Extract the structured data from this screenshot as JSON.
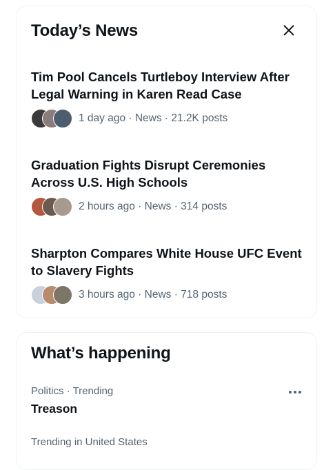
{
  "news": {
    "title": "Today’s News",
    "close_icon": "close-icon",
    "stories": [
      {
        "title": "Tim Pool Cancels Turtleboy Interview After Legal Warning in Karen Read Case",
        "meta": "1 day ago · News · 21.2K posts",
        "avatar_colors": [
          "#3b3b3b",
          "#8a7c78",
          "#4b5d6e"
        ]
      },
      {
        "title": "Graduation Fights Disrupt Ceremonies Across U.S. High Schools",
        "meta": "2 hours ago · News · 314 posts",
        "avatar_colors": [
          "#b4583e",
          "#6d5a4e",
          "#a89a8e"
        ]
      },
      {
        "title": "Sharpton Compares White House UFC Event to Slavery Fights",
        "meta": "3 hours ago · News · 718 posts",
        "avatar_colors": [
          "#c8d2dc",
          "#b98a6e",
          "#7d7566"
        ]
      }
    ]
  },
  "happening": {
    "title": "What’s happening",
    "trends": [
      {
        "context": "Politics · Trending",
        "name": "Treason",
        "more_icon": "more-icon"
      },
      {
        "context": "Trending in United States"
      }
    ]
  }
}
